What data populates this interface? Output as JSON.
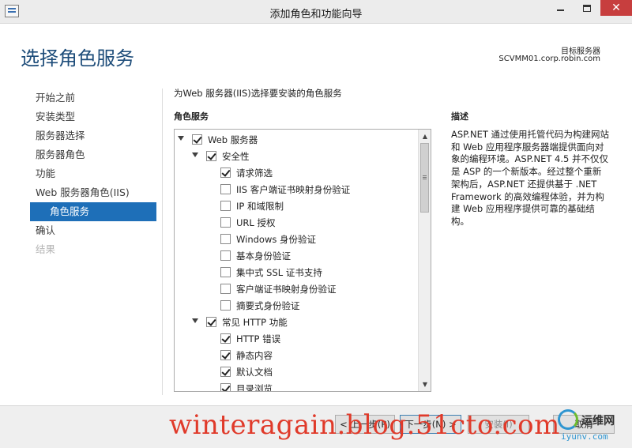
{
  "window": {
    "title": "添加角色和功能向导",
    "close_glyph": "✕"
  },
  "header": {
    "page_title": "选择角色服务",
    "destination_label": "目标服务器",
    "destination_value": "SCVMM01.corp.robin.com"
  },
  "nav": {
    "items": [
      {
        "label": "开始之前",
        "state": "normal"
      },
      {
        "label": "安装类型",
        "state": "normal"
      },
      {
        "label": "服务器选择",
        "state": "normal"
      },
      {
        "label": "服务器角色",
        "state": "normal"
      },
      {
        "label": "功能",
        "state": "normal"
      },
      {
        "label": "Web 服务器角色(IIS)",
        "state": "normal"
      },
      {
        "label": "角色服务",
        "state": "active"
      },
      {
        "label": "确认",
        "state": "normal"
      },
      {
        "label": "结果",
        "state": "disabled"
      }
    ]
  },
  "main": {
    "instruction": "为Web 服务器(IIS)选择要安装的角色服务",
    "role_services_header": "角色服务",
    "tree": [
      {
        "label": "Web 服务器",
        "checked": true,
        "expanded": true,
        "level": 0
      },
      {
        "label": "安全性",
        "checked": true,
        "expanded": true,
        "level": 1
      },
      {
        "label": "请求筛选",
        "checked": true,
        "level": 2
      },
      {
        "label": "IIS 客户端证书映射身份验证",
        "checked": false,
        "level": 2
      },
      {
        "label": "IP 和域限制",
        "checked": false,
        "level": 2
      },
      {
        "label": "URL 授权",
        "checked": false,
        "level": 2
      },
      {
        "label": "Windows 身份验证",
        "checked": false,
        "level": 2
      },
      {
        "label": "基本身份验证",
        "checked": false,
        "level": 2
      },
      {
        "label": "集中式 SSL 证书支持",
        "checked": false,
        "level": 2
      },
      {
        "label": "客户端证书映射身份验证",
        "checked": false,
        "level": 2
      },
      {
        "label": "摘要式身份验证",
        "checked": false,
        "level": 2
      },
      {
        "label": "常见 HTTP 功能",
        "checked": true,
        "expanded": true,
        "level": 1
      },
      {
        "label": "HTTP 错误",
        "checked": true,
        "level": 2
      },
      {
        "label": "静态内容",
        "checked": true,
        "level": 2
      },
      {
        "label": "默认文档",
        "checked": true,
        "level": 2
      },
      {
        "label": "目录浏览",
        "checked": true,
        "level": 2
      }
    ]
  },
  "description": {
    "header": "描述",
    "text": "ASP.NET 通过使用托管代码为构建网站和 Web 应用程序服务器端提供面向对象的编程环境。ASP.NET 4.5 并不仅仅是 ASP 的一个新版本。经过整个重新架构后，ASP.NET 还提供基于 .NET Framework 的高效编程体验，并为构建 Web 应用程序提供可靠的基础结构。"
  },
  "footer": {
    "prev_label": "< 上一步(P)",
    "next_label": "下一步(N) >",
    "install_label": "安装(I)",
    "cancel_label": "取消"
  },
  "watermark": {
    "text": "winteragain.blog.51cto.com",
    "logo_text": "运维网",
    "logo_domain": "iyunv.com"
  },
  "icons": {
    "scroll_up": "▲",
    "scroll_down": "▼"
  }
}
